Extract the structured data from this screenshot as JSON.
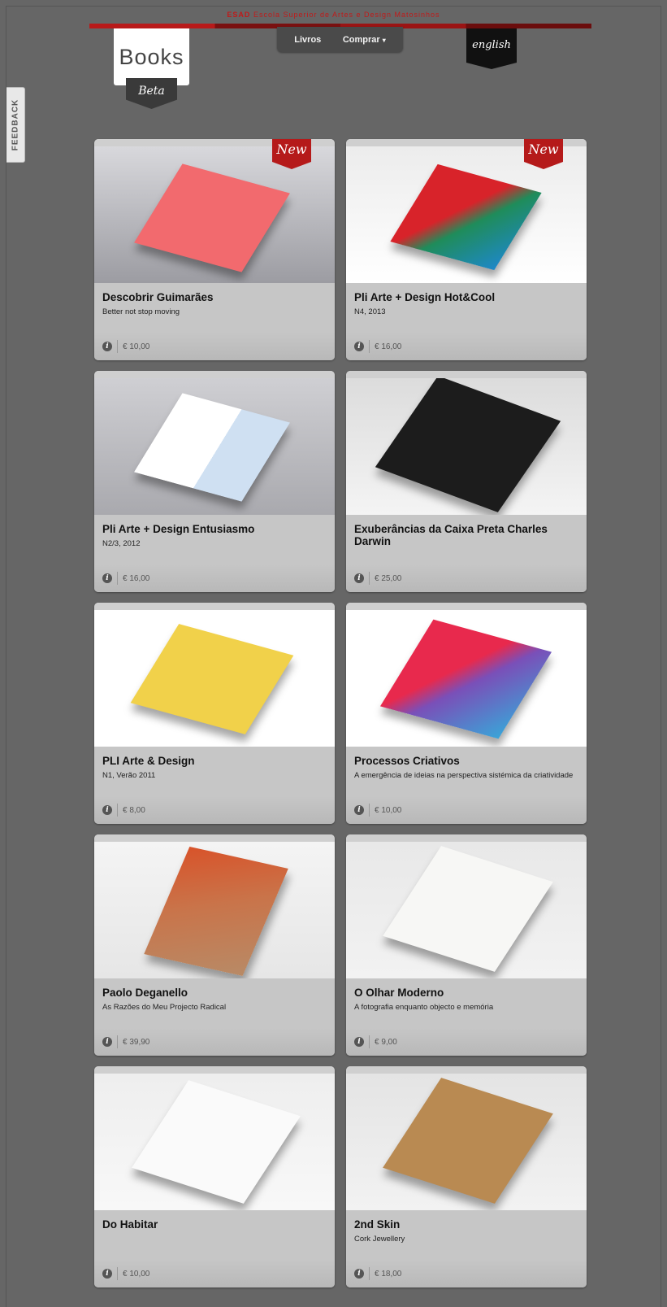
{
  "header": {
    "school_abbr": "ESAD",
    "school_name": "Escola Superior de Artes e Design Matosinhos",
    "logo_text": "Books",
    "beta_label": "Beta",
    "nav": [
      {
        "label": "Livros"
      },
      {
        "label": "Comprar",
        "caret": "▾"
      }
    ],
    "language_label": "english"
  },
  "feedback_label": "FEEDBACK",
  "new_label": "New",
  "books": [
    {
      "title": "Descobrir Guimarães",
      "subtitle": "Better not stop moving",
      "price": "€ 10,00",
      "is_new": true
    },
    {
      "title": "Pli Arte + Design  Hot&Cool",
      "subtitle": "N4, 2013",
      "price": "€ 16,00",
      "is_new": true
    },
    {
      "title": "Pli Arte + Design  Entusiasmo",
      "subtitle": "N2/3, 2012",
      "price": "€ 16,00",
      "is_new": false
    },
    {
      "title": "Exuberâncias da Caixa Preta Charles Darwin",
      "subtitle": "",
      "price": "€ 25,00",
      "is_new": false
    },
    {
      "title": "PLI Arte & Design",
      "subtitle": "N1, Verão 2011",
      "price": "€ 8,00",
      "is_new": false
    },
    {
      "title": "Processos Criativos",
      "subtitle": "A emergência de ideias na perspectiva sistémica da criatividade",
      "price": "€ 10,00",
      "is_new": false
    },
    {
      "title": "Paolo Deganello",
      "subtitle": "As Razões do Meu Projecto Radical",
      "price": "€ 39,90",
      "is_new": false
    },
    {
      "title": "O Olhar Moderno",
      "subtitle": "A fotografia enquanto objecto e memória",
      "price": "€ 9,00",
      "is_new": false
    },
    {
      "title": "Do Habitar",
      "subtitle": "",
      "price": "€ 10,00",
      "is_new": false
    },
    {
      "title": "2nd Skin",
      "subtitle": "Cork Jewellery",
      "price": "€ 18,00",
      "is_new": false
    }
  ],
  "info_icon": "i",
  "colors": {
    "page_bg": "#666666",
    "accent_red": "#b51a1a",
    "card_bg": "#c6c6c6",
    "nav_bg": "#4a4a4a"
  }
}
